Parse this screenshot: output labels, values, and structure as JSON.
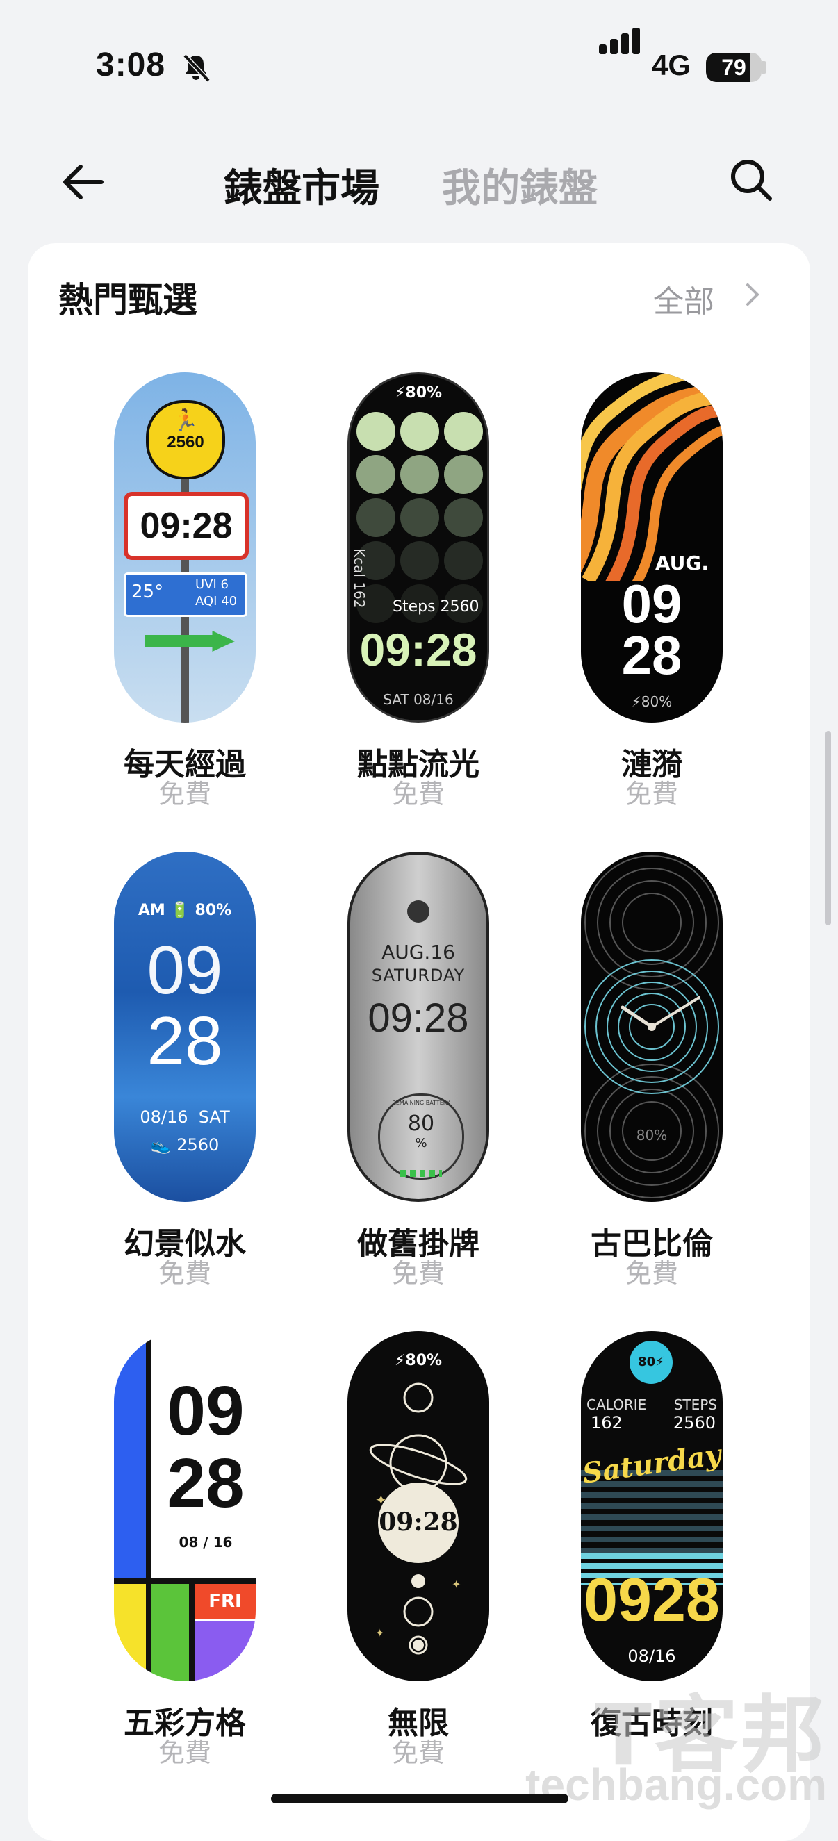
{
  "status_bar": {
    "time": "3:08",
    "network": "4G",
    "battery": "79",
    "battery_level": 0.79
  },
  "header": {
    "tab_market": "錶盤市場",
    "tab_mine": "我的錶盤"
  },
  "section": {
    "title": "熱門甄選",
    "see_all": "全部"
  },
  "watch_faces": [
    {
      "name": "每天經過",
      "price": "免費",
      "badge": "2560",
      "time": "09:28",
      "temp": "25°",
      "uvi": "UVI 6",
      "aqi": "AQI 40"
    },
    {
      "name": "點點流光",
      "price": "免費",
      "battery": "⚡80%",
      "kcal": "Kcal 162",
      "steps": "Steps 2560",
      "time": "09:28",
      "date": "SAT 08/16"
    },
    {
      "name": "漣漪",
      "price": "免費",
      "month": "AUG.",
      "hour": "09",
      "minute": "28",
      "battery": "⚡80%"
    },
    {
      "name": "幻景似水",
      "price": "免費",
      "top": "AM 🔋 80%",
      "hour": "09",
      "minute": "28",
      "date": "08/16  SAT",
      "steps": "👟 2560"
    },
    {
      "name": "做舊掛牌",
      "price": "免費",
      "date": "AUG.16",
      "day": "SATURDAY",
      "time": "09:28",
      "ring": "REMAINING BATTERY",
      "battery": "80",
      "unit": "%"
    },
    {
      "name": "古巴比倫",
      "price": "免費",
      "battery": "80%"
    },
    {
      "name": "五彩方格",
      "price": "免費",
      "hour": "09",
      "minute": "28",
      "date": "08 / 16",
      "day": "FRI"
    },
    {
      "name": "無限",
      "price": "免費",
      "battery": "⚡80%",
      "time": "09:28"
    },
    {
      "name": "復古時刻",
      "price": "免費",
      "badge": "80⚡",
      "cal_label": "CALORIE",
      "cal": "162",
      "steps_label": "STEPS",
      "steps": "2560",
      "day": "Saturday",
      "time": "0928",
      "date": "08/16"
    }
  ],
  "watermark": {
    "text": "techbang.com",
    "logo": "T客邦"
  },
  "colors": {
    "accent_gray": "#a9a9ad",
    "card": "#ffffff",
    "background": "#f2f3f5"
  }
}
